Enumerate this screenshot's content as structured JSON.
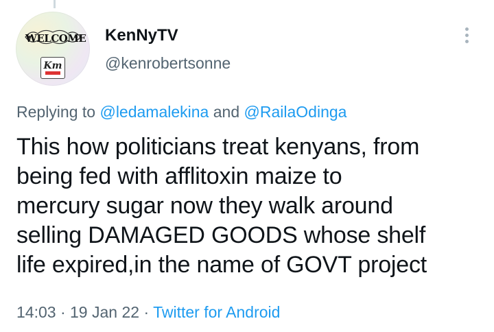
{
  "tweet": {
    "author": {
      "display_name": "KenNyTV",
      "handle": "@kenrobertsonne",
      "avatar": {
        "banner_text": "WELCOME",
        "logo_text": "Km"
      }
    },
    "reply_context": {
      "prefix": "Replying to",
      "mentions": [
        "@ledamalekina",
        "@RailaOdinga"
      ],
      "conjunction": "and"
    },
    "text_lines": [
      "This how politicians treat kenyans, from",
      "being fed with afflitoxin maize to",
      "mercury sugar now they walk around",
      "selling DAMAGED GOODS whose shelf",
      "life expired,in the name of GOVT project"
    ],
    "meta": {
      "time": "14:03",
      "date": "19 Jan 22",
      "separator": "·",
      "source": "Twitter for Android"
    }
  },
  "icons": {
    "more": "more-options-icon"
  },
  "colors": {
    "text_primary": "#0f1419",
    "text_secondary": "#536471",
    "link": "#1d9bf0"
  }
}
